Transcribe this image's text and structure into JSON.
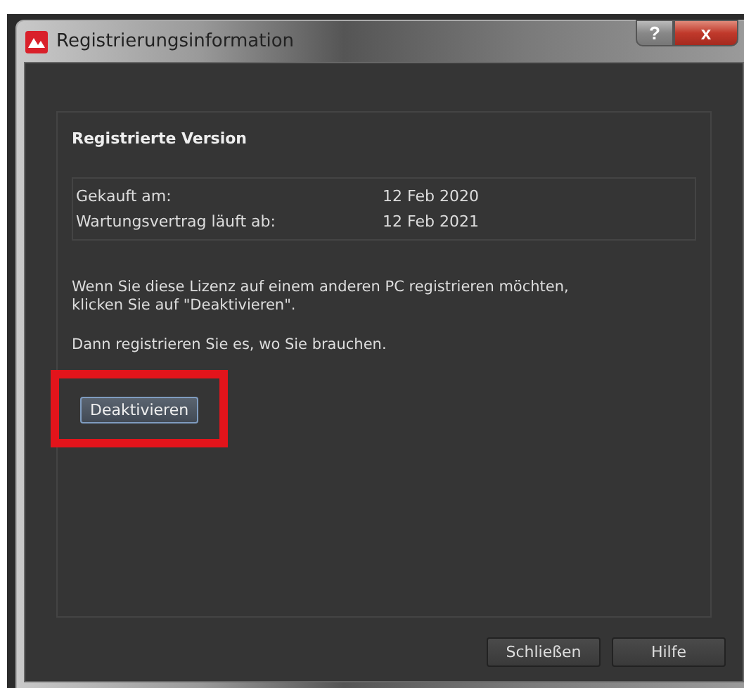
{
  "window": {
    "title": "Registrierungsinformation",
    "title_buttons": [
      {
        "kind": "help",
        "label": "?"
      },
      {
        "kind": "close",
        "label": "x"
      }
    ]
  },
  "section": {
    "heading": "Registrierte Version",
    "info": [
      {
        "label": "Gekauft am:",
        "value": "12 Feb 2020"
      },
      {
        "label": "Wartungsvertrag läuft ab:",
        "value": "12 Feb 2021"
      }
    ],
    "paragraphs": [
      "Wenn Sie diese Lizenz auf einem anderen PC registrieren möchten,\nklicken Sie auf \"Deaktivieren\".",
      "Dann registrieren Sie es, wo Sie brauchen."
    ],
    "action": {
      "label": "Deaktivieren",
      "highlighted": true
    }
  },
  "buttons": [
    "Schließen",
    "Hilfe"
  ]
}
